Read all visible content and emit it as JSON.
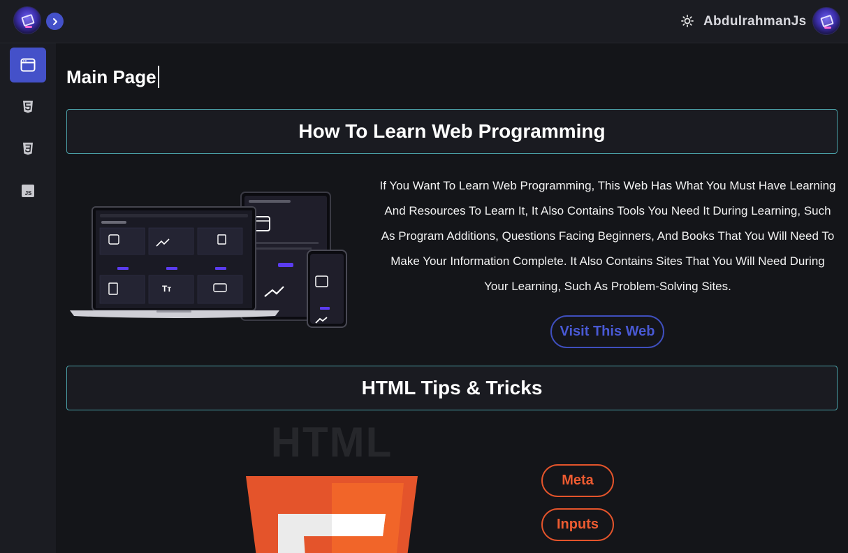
{
  "topbar": {
    "username": "AbdulrahmanJs",
    "expand_icon": "chevron-right-icon",
    "theme_icon": "sun-icon"
  },
  "sidebar": {
    "items": [
      {
        "name": "browser-window-icon",
        "active": true
      },
      {
        "name": "html5-icon",
        "active": false
      },
      {
        "name": "css3-icon",
        "active": false
      },
      {
        "name": "js-icon",
        "active": false
      }
    ]
  },
  "main": {
    "page_title": "Main Page",
    "sections": [
      {
        "title": "How To Learn Web Programming",
        "description": "If You Want To Learn Web Programming, This Web Has What You Must Have Learning And Resources To Learn It, It Also Contains Tools You Need It During Learning, Such As Program Additions, Questions Facing Beginners, And Books That You Will Need To Make Your Information Complete. It Also Contains Sites That You Will Need During Your Learning, Such As Problem-Solving Sites.",
        "button_label": "Visit This Web"
      },
      {
        "title": "HTML Tips & Tricks",
        "logo_text": "HTML",
        "buttons": [
          "Meta",
          "Inputs"
        ]
      }
    ]
  },
  "colors": {
    "accent": "#4451c9",
    "html_orange": "#e4542b",
    "section_border": "#4a9fa6",
    "background": "#141519",
    "panel": "#1b1c22"
  }
}
